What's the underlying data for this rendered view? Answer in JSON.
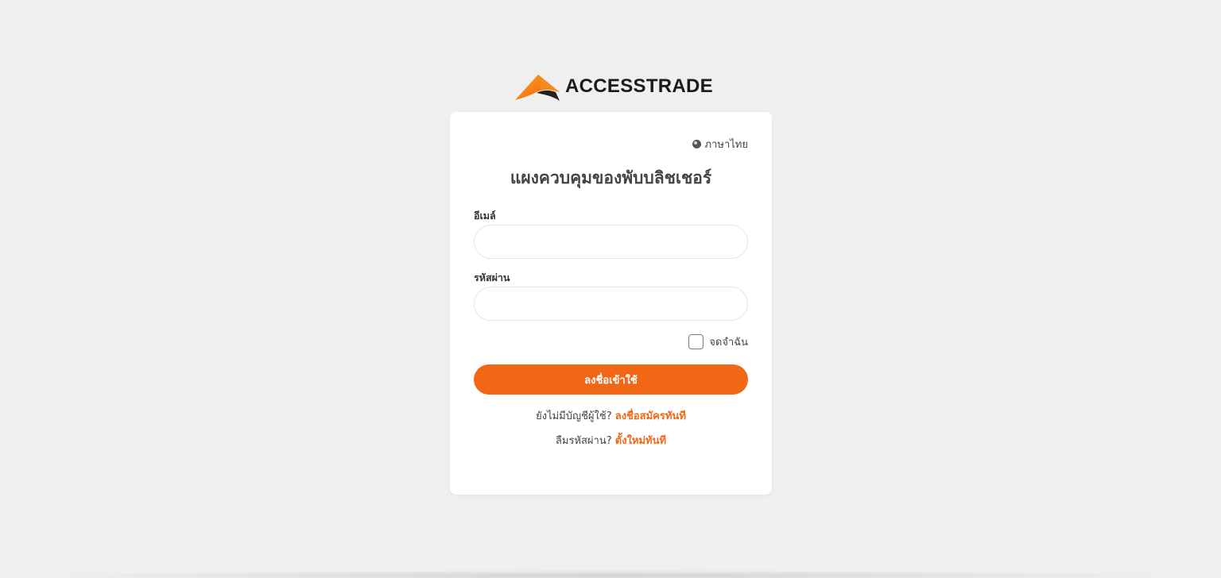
{
  "brand": {
    "name": "ACCESSTRADE",
    "accent_color": "#f26716",
    "logo_icon": "accesstrade-mountain-logo"
  },
  "language": {
    "icon": "globe-icon",
    "label": "ภาษาไทย"
  },
  "form": {
    "title": "แผงควบคุมของพับบลิชเชอร์",
    "email_label": "อีเมล์",
    "email_value": "",
    "password_label": "รหัสผ่าน",
    "password_value": "",
    "remember_label": "จดจำฉัน",
    "remember_checked": false,
    "submit_label": "ลงชื่อเข้าใช้"
  },
  "links": {
    "signup_prompt": "ยังไม่มีบัญชีผู้ใช้?",
    "signup_link": "ลงชื่อสมัครทันที",
    "forgot_prompt": "ลืมรหัสผ่าน?",
    "forgot_link": "ตั้งใหม่ทันที"
  }
}
